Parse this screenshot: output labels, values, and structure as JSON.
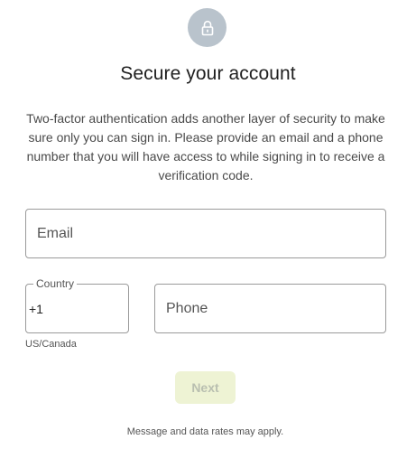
{
  "header": {
    "icon": "lock-icon",
    "title": "Secure your account",
    "description": "Two-factor authentication adds another layer of security to make sure only you can sign in. Please provide an email and a phone number that you will have access to while signing in to receive a verification code."
  },
  "form": {
    "email": {
      "placeholder": "Email",
      "value": ""
    },
    "country": {
      "label": "Country",
      "value": "+1",
      "hint": "US/Canada"
    },
    "phone": {
      "placeholder": "Phone",
      "value": ""
    },
    "next_label": "Next",
    "next_enabled": false
  },
  "footer": {
    "note": "Message and data rates may apply."
  },
  "colors": {
    "lock_badge": "#b9c3cc",
    "next_button_bg_disabled": "#eef3d4",
    "next_button_text_disabled": "#b9bfb0",
    "field_border": "#9a9a9a"
  }
}
